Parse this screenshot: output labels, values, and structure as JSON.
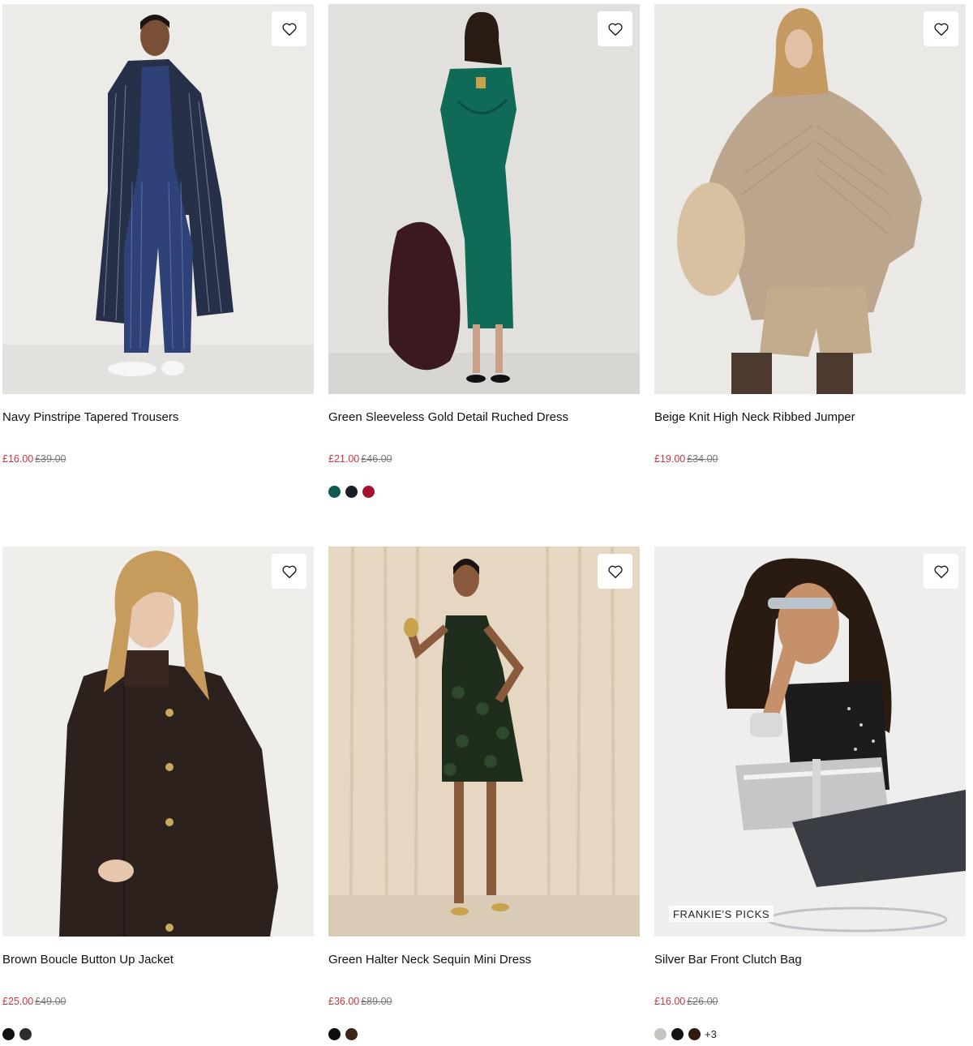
{
  "products": [
    {
      "title": "Navy Pinstripe Tapered Trousers",
      "sale_price": "£16.00",
      "was_price": "£39.00",
      "swatches": [],
      "more": "",
      "badge": "",
      "image_bg": "#eceae7"
    },
    {
      "title": "Green Sleeveless Gold Detail Ruched Dress",
      "sale_price": "£21.00",
      "was_price": "£46.00",
      "swatches": [
        "#0c5a52",
        "#1c1d25",
        "#a6122e"
      ],
      "more": "",
      "badge": "",
      "image_bg": "#e4e2de"
    },
    {
      "title": "Beige Knit High Neck Ribbed Jumper",
      "sale_price": "£19.00",
      "was_price": "£34.00",
      "swatches": [],
      "more": "",
      "badge": "",
      "image_bg": "#ebe9e5"
    },
    {
      "title": "Brown Boucle Button Up Jacket",
      "sale_price": "£25.00",
      "was_price": "£49.00",
      "swatches": [
        "#111111",
        "#2d2b30"
      ],
      "more": "",
      "badge": "",
      "image_bg": "#efeeeb"
    },
    {
      "title": "Green Halter Neck Sequin Mini Dress",
      "sale_price": "£36.00",
      "was_price": "£89.00",
      "swatches": [
        "#0d0f0d",
        "#3a2416"
      ],
      "more": "",
      "badge": "",
      "image_bg": "#e6d7c2"
    },
    {
      "title": "Silver Bar Front Clutch Bag",
      "sale_price": "£16.00",
      "was_price": "£26.00",
      "swatches": [
        "#c5c5bd",
        "#141414",
        "#2e1a10"
      ],
      "more": "+3",
      "badge": "FRANKIE'S PICKS",
      "image_bg": "#eeeeec"
    }
  ],
  "icons": {
    "wishlist": "heart-outline-icon"
  },
  "colors": {
    "sale": "#c8353d",
    "was": "#777777"
  }
}
